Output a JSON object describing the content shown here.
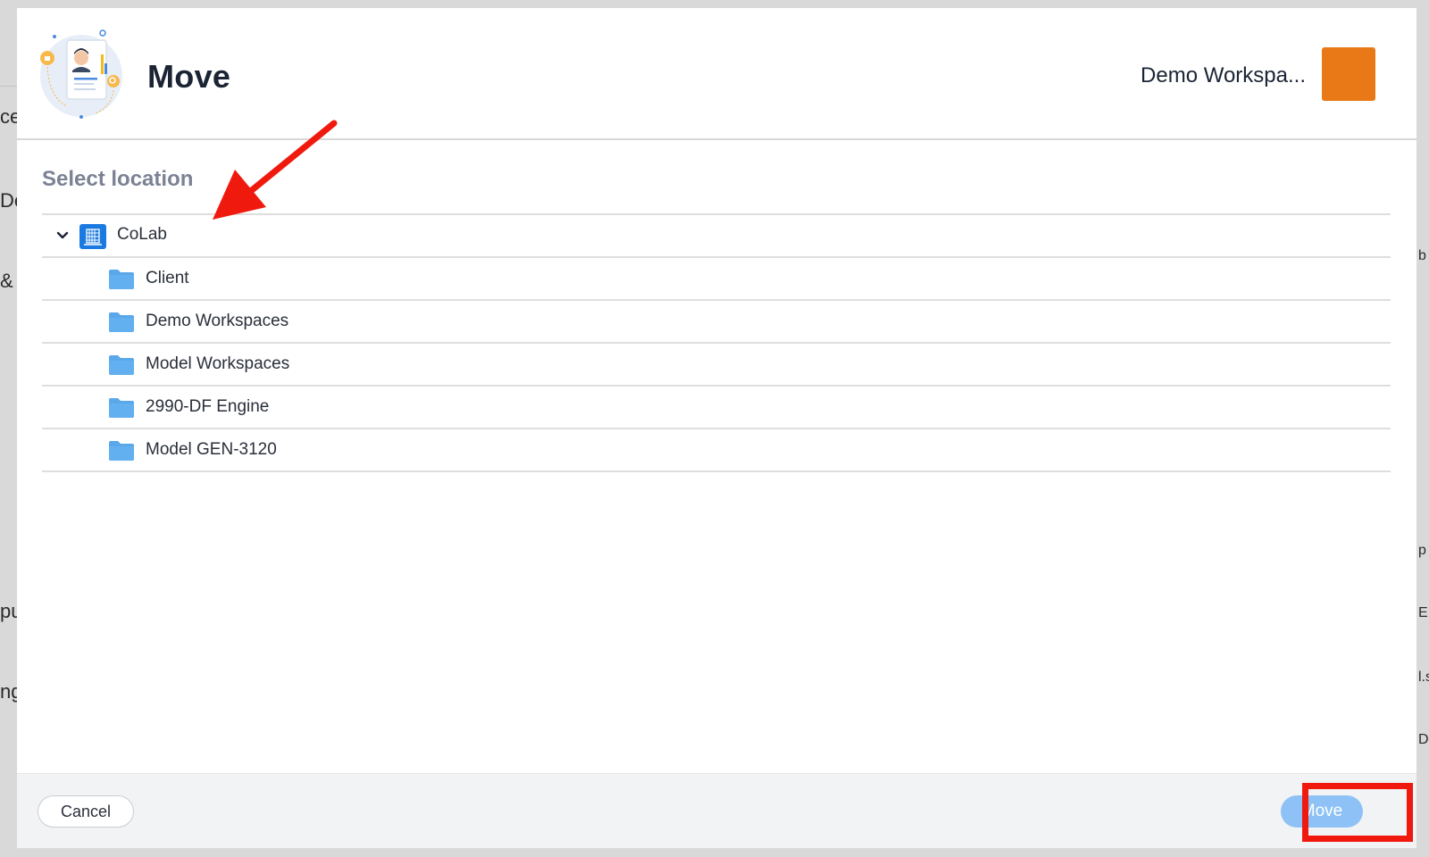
{
  "background": {
    "left_fragments": [
      "ce",
      "De",
      "& T",
      "pu",
      "ng"
    ],
    "right_fragments": [
      "b",
      "p",
      "E",
      "l.s",
      "D"
    ]
  },
  "dialog": {
    "title": "Move",
    "illustration_icon": "document-profile-illustration",
    "workspace": {
      "name": "Demo Workspa...",
      "avatar_color": "#e97817"
    }
  },
  "location": {
    "label": "Select location",
    "root": {
      "label": "CoLab",
      "icon": "org-building-icon",
      "expanded": true,
      "children": [
        {
          "label": "Client",
          "icon": "folder-icon"
        },
        {
          "label": "Demo Workspaces",
          "icon": "folder-icon"
        },
        {
          "label": "Model Workspaces",
          "icon": "folder-icon"
        },
        {
          "label": "2990-DF Engine",
          "icon": "folder-icon"
        },
        {
          "label": "Model GEN-3120",
          "icon": "folder-icon"
        }
      ]
    }
  },
  "footer": {
    "cancel_label": "Cancel",
    "move_label": "Move",
    "move_disabled": true
  },
  "annotations": {
    "arrow_color": "#f0190e",
    "highlight_color": "#f0190e"
  },
  "colors": {
    "primary_blue": "#1b7ae2",
    "folder_blue": "#5aa7ea",
    "move_button_disabled": "#8ec2f6"
  }
}
